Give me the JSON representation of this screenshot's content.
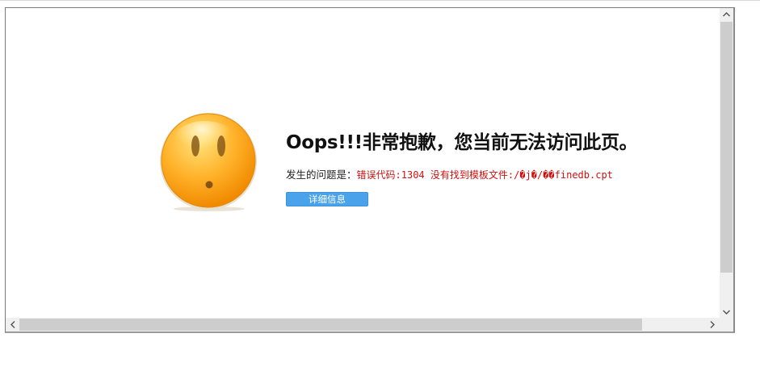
{
  "error_page": {
    "title": "Oops!!!非常抱歉，您当前无法访问此页。",
    "detail_label": "发生的问题是：",
    "detail_error": "错误代码:1304 没有找到模板文件:/�j�/��finedb.cpt",
    "details_button_label": "详细信息",
    "face_icon": "sad-smiley-icon"
  },
  "scrollbars": {
    "vertical": {
      "up_icon": "chevron-up-icon",
      "down_icon": "chevron-down-icon"
    },
    "horizontal": {
      "left_icon": "chevron-left-icon",
      "right_icon": "chevron-right-icon"
    }
  },
  "colors": {
    "error_text": "#cc1111",
    "button_bg": "#4aa3ea",
    "face_orange": "#ffa317"
  }
}
